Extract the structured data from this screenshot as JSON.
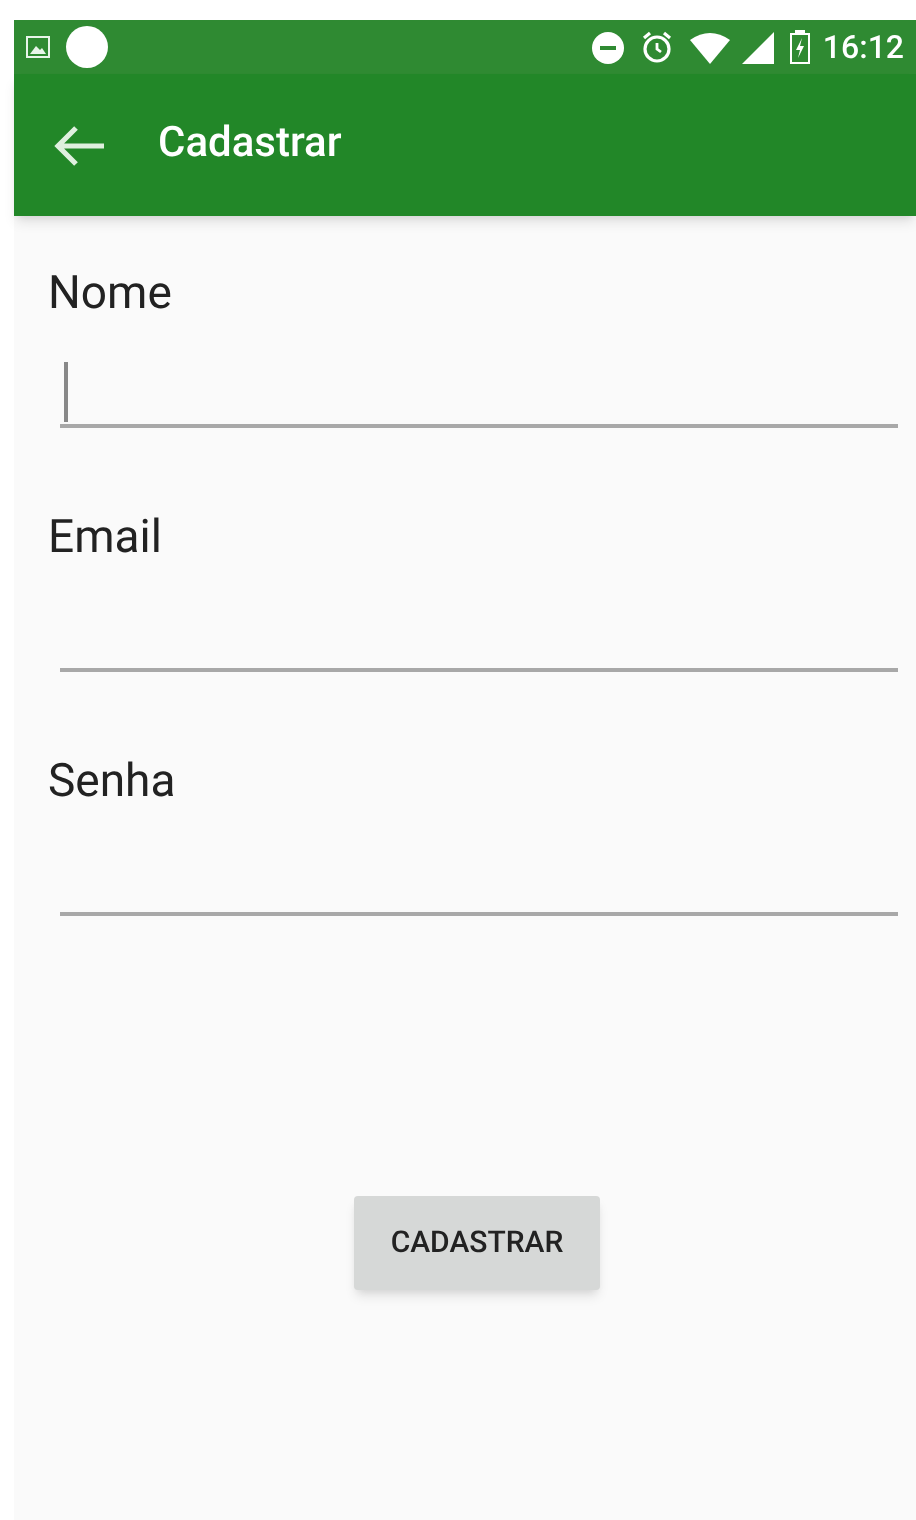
{
  "status_bar": {
    "time": "16:12"
  },
  "app_bar": {
    "title": "Cadastrar"
  },
  "fields": [
    {
      "label": "Nome",
      "focused": true
    },
    {
      "label": "Email",
      "focused": false
    },
    {
      "label": "Senha",
      "focused": false
    }
  ],
  "button": {
    "label": "CADASTRAR"
  }
}
